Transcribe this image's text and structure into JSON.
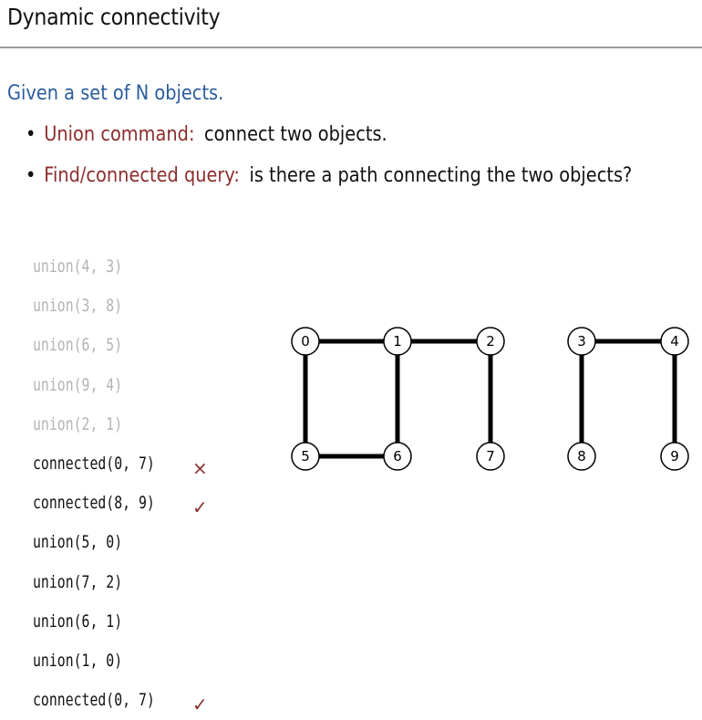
{
  "slide": {
    "title": "Dynamic connectivity",
    "intro": "Given a set of N objects.",
    "bullets": [
      {
        "dot": "•",
        "term": "Union command:",
        "text": "connect two objects."
      },
      {
        "dot": "•",
        "term": "Find/connected query:",
        "text": "is there a path connecting the two objects?"
      }
    ]
  },
  "commands": [
    {
      "text": "union(4, 3)",
      "state": "faded",
      "mark": ""
    },
    {
      "text": "union(3, 8)",
      "state": "faded",
      "mark": ""
    },
    {
      "text": "union(6, 5)",
      "state": "faded",
      "mark": ""
    },
    {
      "text": "union(9, 4)",
      "state": "faded",
      "mark": ""
    },
    {
      "text": "union(2, 1)",
      "state": "faded",
      "mark": ""
    },
    {
      "text": "connected(0, 7)",
      "state": "active",
      "mark": "×"
    },
    {
      "text": "connected(8, 9)",
      "state": "active",
      "mark": "✓"
    },
    {
      "text": "union(5, 0)",
      "state": "active",
      "mark": ""
    },
    {
      "text": "union(7, 2)",
      "state": "active",
      "mark": ""
    },
    {
      "text": "union(6, 1)",
      "state": "active",
      "mark": ""
    },
    {
      "text": "union(1, 0)",
      "state": "active",
      "mark": ""
    },
    {
      "text": "connected(0, 7)",
      "state": "active",
      "mark": "✓"
    }
  ],
  "graph": {
    "nodes": [
      "0",
      "1",
      "2",
      "3",
      "4",
      "5",
      "6",
      "7",
      "8",
      "9"
    ],
    "edges": [
      [
        "0",
        "1"
      ],
      [
        "1",
        "2"
      ],
      [
        "3",
        "4"
      ],
      [
        "0",
        "5"
      ],
      [
        "1",
        "6"
      ],
      [
        "2",
        "7"
      ],
      [
        "3",
        "8"
      ],
      [
        "4",
        "9"
      ],
      [
        "5",
        "6"
      ]
    ]
  }
}
